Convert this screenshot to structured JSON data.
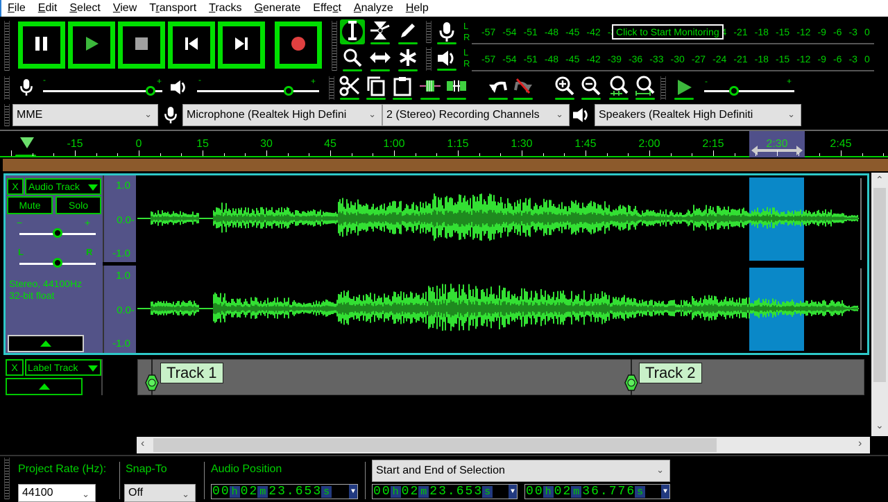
{
  "menu": [
    "File",
    "Edit",
    "Select",
    "View",
    "Transport",
    "Tracks",
    "Generate",
    "Effect",
    "Analyze",
    "Help"
  ],
  "menu_accel": [
    "F",
    "E",
    "S",
    "V",
    "r",
    "T",
    "G",
    "c",
    "A",
    "H"
  ],
  "transport": {
    "buttons": [
      {
        "name": "pause",
        "icon": "pause-icon"
      },
      {
        "name": "play",
        "icon": "play-icon"
      },
      {
        "name": "stop",
        "icon": "stop-icon"
      },
      {
        "name": "skip-to-start",
        "icon": "skip-start-icon"
      },
      {
        "name": "skip-to-end",
        "icon": "skip-end-icon"
      },
      {
        "name": "record",
        "icon": "record-icon"
      }
    ],
    "colors": {
      "frame": "#00e000",
      "play": "#3cb83c",
      "stop": "#a0a0a0",
      "record": "#e04040"
    }
  },
  "tools": [
    "selection-tool",
    "envelope-tool",
    "draw-tool",
    "zoom-tool",
    "time-shift-tool",
    "multi-tool"
  ],
  "meters": {
    "record_tooltip": "Click to Start Monitoring",
    "scale": [
      "-57",
      "-54",
      "-51",
      "-48",
      "-45",
      "-42",
      "-39",
      "-36",
      "-33",
      "-30",
      "-27",
      "-24",
      "-21",
      "-18",
      "-15",
      "-12",
      "-9",
      "-6",
      "-3",
      "0"
    ],
    "record_scale_visible_right": [
      "21",
      "-18",
      "-15",
      "-12",
      "-9",
      "-6",
      "-3",
      "0"
    ],
    "record_scale_visible_left": [
      "-57",
      "-54",
      "-51",
      "-48",
      "-45",
      "-42",
      "-3"
    ],
    "channel_labels": [
      "L",
      "R"
    ]
  },
  "mixer": {
    "record_volume": 0.9,
    "playback_volume": 0.75,
    "minus": "-",
    "plus": "+"
  },
  "edit_tools": [
    "cut",
    "copy",
    "paste",
    "trim-audio",
    "silence-audio",
    "undo",
    "redo",
    "zoom-in",
    "zoom-out",
    "fit-selection",
    "fit-project"
  ],
  "play_at_speed": {
    "speed": 0.33,
    "minus": "-",
    "plus": "+"
  },
  "devices": {
    "host": "MME",
    "recording_device": "Microphone (Realtek High Defini",
    "channels": "2 (Stereo) Recording Channels",
    "playback_device": "Speakers (Realtek High Definiti"
  },
  "ruler": {
    "labels": [
      "-15",
      "0",
      "15",
      "30",
      "45",
      "1:00",
      "1:15",
      "1:30",
      "1:45",
      "2:00",
      "2:15",
      "2:30",
      "2:45"
    ],
    "selection_label": "2:30"
  },
  "audio_track": {
    "name": "Audio Track",
    "close": "X",
    "mute": "Mute",
    "solo": "Solo",
    "gain_minus": "−",
    "gain_plus": "+",
    "pan_left": "L",
    "pan_right": "R",
    "gain": 0.5,
    "pan": 0.5,
    "info_line1": "Stereo, 44100Hz",
    "info_line2": "32-bit float",
    "vruler": [
      "1.0",
      "0.0-",
      "-1.0"
    ],
    "selection_color": "#0a88c8",
    "wave_color": "#33e033",
    "wave_dark": "#1f8a1f"
  },
  "label_track": {
    "name": "Label Track",
    "close": "X",
    "labels": [
      "Track 1",
      "Track 2"
    ]
  },
  "status": {
    "project_rate_label": "Project Rate (Hz):",
    "project_rate": "44100",
    "snap_label": "Snap-To",
    "snap": "Off",
    "audio_position_label": "Audio Position",
    "selection_mode": "Start and End of Selection",
    "audio_position": [
      "0",
      "0",
      "h",
      "0",
      "2",
      "m",
      "2",
      "3",
      ".",
      "6",
      "5",
      "3",
      "s"
    ],
    "sel_start": [
      "0",
      "0",
      "h",
      "0",
      "2",
      "m",
      "2",
      "3",
      ".",
      "6",
      "5",
      "3",
      "s"
    ],
    "sel_end": [
      "0",
      "0",
      "h",
      "0",
      "2",
      "m",
      "3",
      "6",
      ".",
      "7",
      "7",
      "6",
      "s"
    ]
  }
}
